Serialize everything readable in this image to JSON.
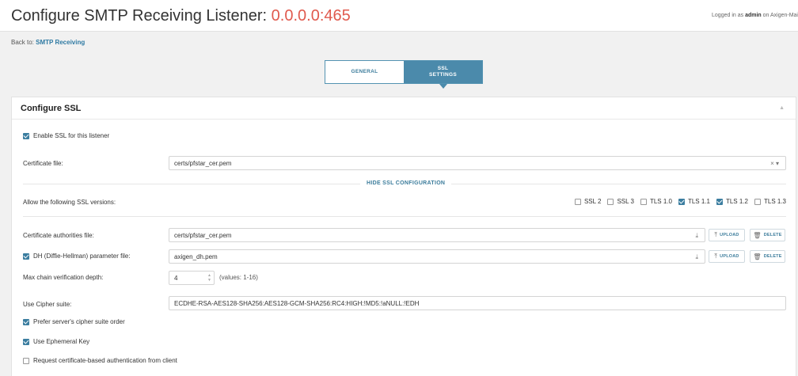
{
  "header": {
    "title_prefix": "Configure SMTP Receiving Listener: ",
    "title_ip": "0.0.0.0:465",
    "login_prefix": "Logged in as ",
    "login_user": "admin",
    "login_suffix": " on Axigen-Mai"
  },
  "breadcrumb": {
    "prefix": "Back to:",
    "link": "SMTP Receiving"
  },
  "tabs": [
    {
      "label": "GENERAL",
      "active": false
    },
    {
      "label_line1": "SSL",
      "label_line2": "SETTINGS",
      "active": true
    }
  ],
  "panel": {
    "title": "Configure SSL",
    "enable_ssl": {
      "label": "Enable SSL for this listener",
      "checked": true
    },
    "certificate_file": {
      "label": "Certificate file:",
      "value": "certs/pfstar_cer.pem"
    },
    "hide_ssl_config": "HIDE SSL CONFIGURATION",
    "ssl_versions": {
      "label": "Allow the following SSL versions:",
      "options": [
        {
          "label": "SSL 2",
          "checked": false
        },
        {
          "label": "SSL 3",
          "checked": false
        },
        {
          "label": "TLS 1.0",
          "checked": false
        },
        {
          "label": "TLS 1.1",
          "checked": true
        },
        {
          "label": "TLS 1.2",
          "checked": true
        },
        {
          "label": "TLS 1.3",
          "checked": false
        }
      ]
    },
    "ca_file": {
      "label": "Certificate authorities file:",
      "value": "certs/pfstar_cer.pem"
    },
    "dh_param": {
      "label": "DH (Diffie-Hellman) parameter file:",
      "value": "axigen_dh.pem",
      "checked": true
    },
    "upload_label": "UPLOAD",
    "delete_label": "DELETE",
    "max_chain": {
      "label": "Max chain verification depth:",
      "value": "4",
      "hint": "(values: 1-16)"
    },
    "cipher_suite": {
      "label": "Use Cipher suite:",
      "value": "ECDHE-RSA-AES128-SHA256:AES128-GCM-SHA256:RC4:HIGH:!MD5:!aNULL:!EDH"
    },
    "prefer_server_order": {
      "label": "Prefer server's cipher suite order",
      "checked": true
    },
    "ephemeral_key": {
      "label": "Use Ephemeral Key",
      "checked": true
    },
    "client_cert_auth": {
      "label": "Request certificate-based authentication from client",
      "checked": false
    }
  },
  "icons": {
    "download": "⤓",
    "clear": "×",
    "dropdown": "▾",
    "collapse": "▲",
    "trash": "🗑"
  },
  "colors": {
    "accent": "#4b8aab",
    "ip": "#e05a4e",
    "link": "#2f7aa3"
  }
}
